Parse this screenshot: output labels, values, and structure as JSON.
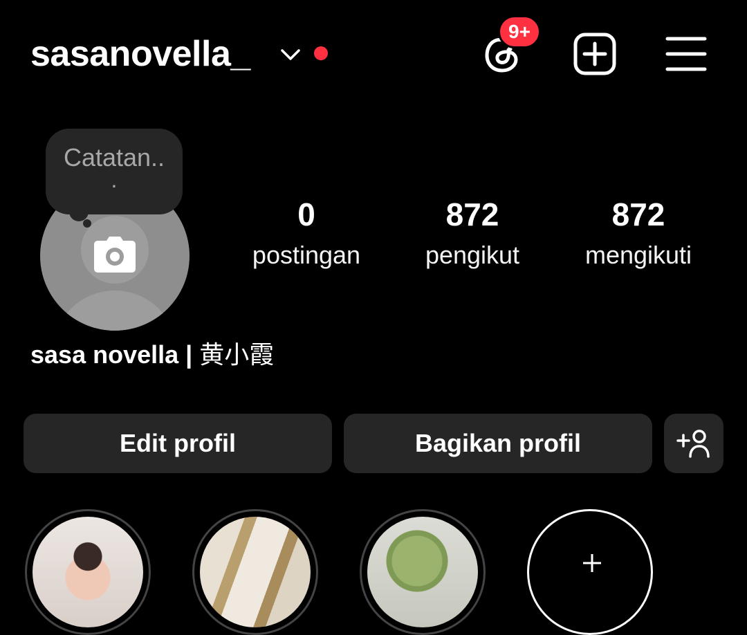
{
  "header": {
    "username": "sasanovella_",
    "threads_badge": "9+"
  },
  "note": {
    "line1": "Catatan..",
    "line2": "."
  },
  "stats": [
    {
      "value": "0",
      "label": "postingan"
    },
    {
      "value": "872",
      "label": "pengikut"
    },
    {
      "value": "872",
      "label": "mengikuti"
    }
  ],
  "profile": {
    "name_latin": "sasa novella | ",
    "name_cjk": "黄小霞"
  },
  "buttons": {
    "edit": "Edit profil",
    "share": "Bagikan profil"
  },
  "icons": {
    "header": [
      "chevron-down-icon",
      "threads-icon",
      "create-icon",
      "menu-icon"
    ],
    "avatar": "camera-icon",
    "discover": "add-person-icon",
    "new_highlight": "plus-icon"
  },
  "colors": {
    "background": "#000000",
    "surface": "#262626",
    "badge": "#ff3040",
    "avatar": "#8e8e8e"
  }
}
